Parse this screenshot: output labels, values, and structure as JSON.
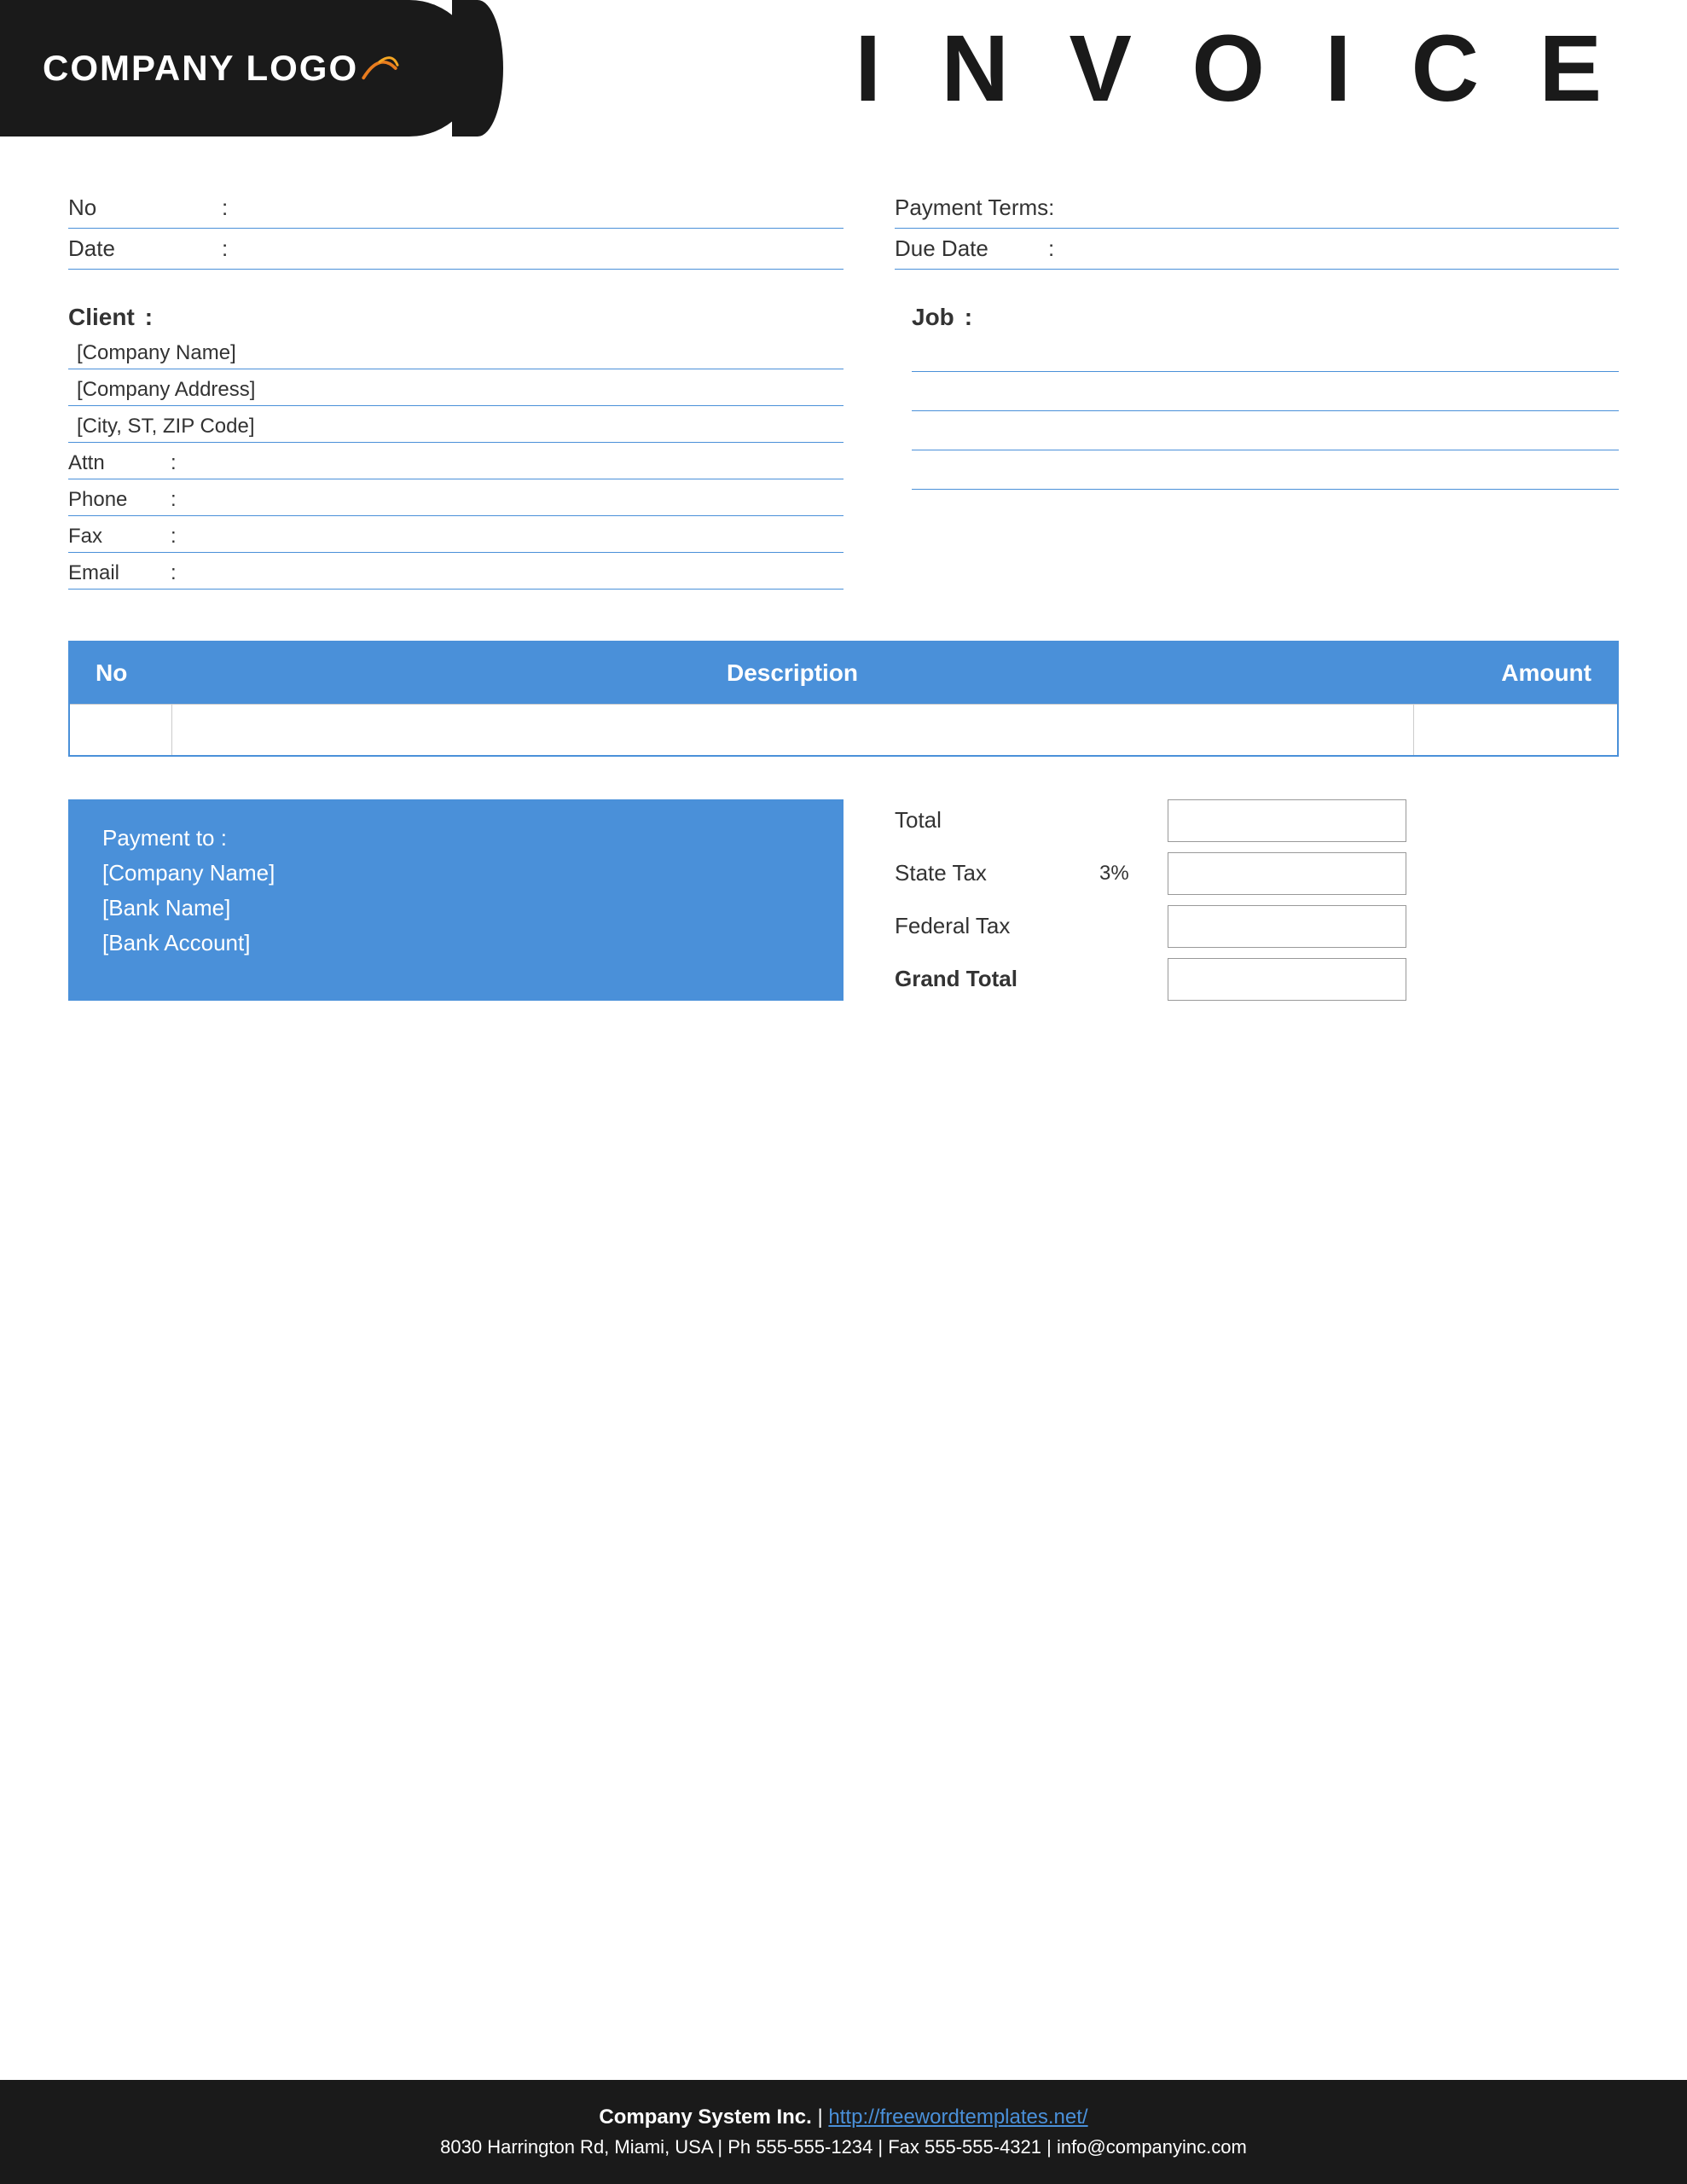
{
  "header": {
    "logo_text": "COMPANY LOGO",
    "title": "I N V O I C E"
  },
  "meta": {
    "no_label": "No",
    "no_colon": ":",
    "no_value": "",
    "date_label": "Date",
    "date_colon": ":",
    "date_value": "",
    "payment_terms_label": "Payment  Terms",
    "payment_terms_colon": ":",
    "payment_terms_value": "",
    "due_date_label": "Due Date",
    "due_date_colon": ":",
    "due_date_value": ""
  },
  "client": {
    "label": "Client",
    "colon": ":",
    "company_name": "[Company Name]",
    "company_address": "[Company Address]",
    "city_zip": "[City, ST, ZIP Code]",
    "attn_label": "Attn",
    "attn_colon": ":",
    "attn_value": "",
    "phone_label": "Phone",
    "phone_colon": ":",
    "phone_value": "",
    "fax_label": "Fax",
    "fax_colon": ":",
    "fax_value": "",
    "email_label": "Email",
    "email_colon": ":",
    "email_value": ""
  },
  "job": {
    "label": "Job",
    "colon": ":",
    "lines": [
      "",
      "",
      "",
      ""
    ]
  },
  "table": {
    "col_no": "No",
    "col_description": "Description",
    "col_amount": "Amount",
    "rows": []
  },
  "payment": {
    "header": "Payment to :",
    "company_name": "[Company Name]",
    "bank_name": "[Bank Name]",
    "bank_account": "[Bank Account]"
  },
  "totals": {
    "total_label": "Total",
    "state_tax_label": "State Tax",
    "state_tax_percent": "3%",
    "federal_tax_label": "Federal Tax",
    "grand_total_label": "Grand Total"
  },
  "footer": {
    "line1_bold": "Company System Inc.",
    "line1_separator": " | ",
    "line1_link": "http://freewordtemplates.net/",
    "line2": "8030 Harrington Rd, Miami, USA | Ph 555-555-1234 | Fax 555-555-4321 | info@companyinc.com"
  }
}
